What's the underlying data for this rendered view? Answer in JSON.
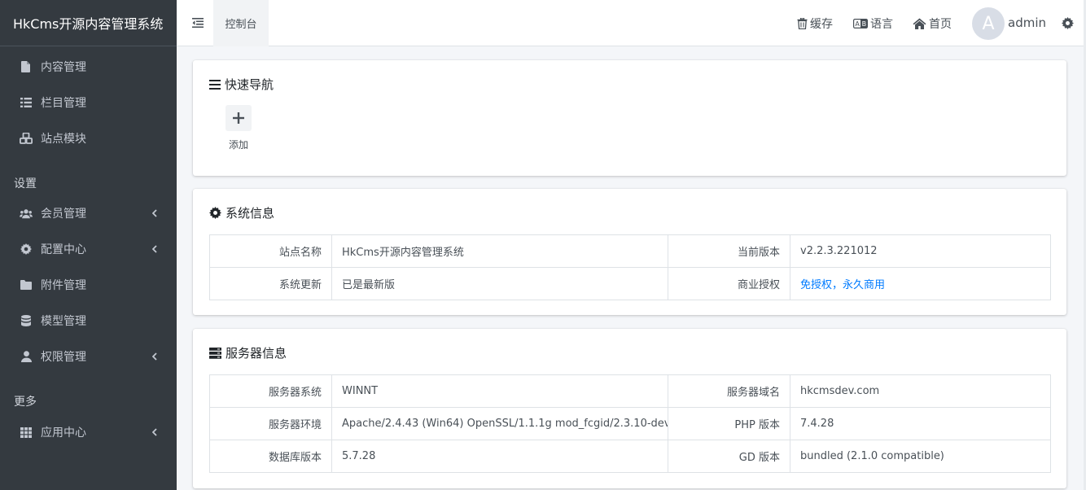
{
  "app": {
    "title": "HkCms开源内容管理系统"
  },
  "sidebar": {
    "items": [
      {
        "label": "内容管理",
        "icon": "file-icon"
      },
      {
        "label": "栏目管理",
        "icon": "list-icon"
      },
      {
        "label": "站点模块",
        "icon": "cubes-icon"
      }
    ],
    "settings_header": "设置",
    "settings_items": [
      {
        "label": "会员管理",
        "icon": "users-icon"
      },
      {
        "label": "配置中心",
        "icon": "cog-icon"
      },
      {
        "label": "附件管理",
        "icon": "folder-icon"
      },
      {
        "label": "模型管理",
        "icon": "database-icon"
      },
      {
        "label": "权限管理",
        "icon": "user-icon"
      }
    ],
    "more_header": "更多",
    "more_items": [
      {
        "label": "应用中心",
        "icon": "grid-icon"
      }
    ]
  },
  "topbar": {
    "tab": "控制台",
    "cache": "缓存",
    "language": "语言",
    "home": "首页",
    "avatar_letter": "A",
    "username": "admin"
  },
  "quick_nav": {
    "title": "快速导航",
    "add_label": "添加"
  },
  "system_info": {
    "title": "系统信息",
    "rows": [
      {
        "k1": "站点名称",
        "v1": "HkCms开源内容管理系统",
        "k2": "当前版本",
        "v2": "v2.2.3.221012"
      },
      {
        "k1": "系统更新",
        "v1": "已是最新版",
        "k2": "商业授权",
        "v2": "免授权，永久商用"
      }
    ]
  },
  "server_info": {
    "title": "服务器信息",
    "rows": [
      {
        "k1": "服务器系统",
        "v1": "WINNT",
        "k2": "服务器域名",
        "v2": "hkcmsdev.com"
      },
      {
        "k1": "服务器环境",
        "v1": "Apache/2.4.43 (Win64) OpenSSL/1.1.1g mod_fcgid/2.3.10-dev",
        "k2": "PHP 版本",
        "v2": "7.4.28"
      },
      {
        "k1": "数据库版本",
        "v1": "5.7.28",
        "k2": "GD 版本",
        "v2": "bundled (2.1.0 compatible)"
      }
    ]
  },
  "colors": {
    "sidebar_bg": "#343a40",
    "link": "#007bff",
    "page_bg": "#f4f6f9"
  }
}
